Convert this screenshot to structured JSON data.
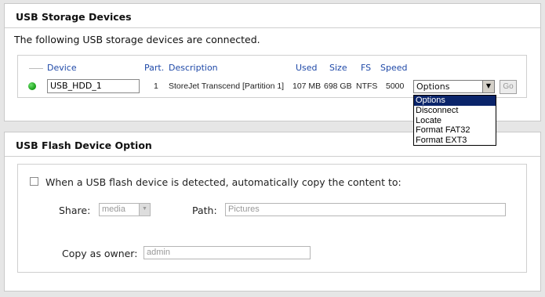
{
  "storage": {
    "title": "USB Storage Devices",
    "subtitle": "The following USB storage devices are connected.",
    "headers": {
      "device": "Device",
      "part": "Part.",
      "description": "Description",
      "used": "Used",
      "size": "Size",
      "fs": "FS",
      "speed": "Speed"
    },
    "row": {
      "status_color": "#1fa81f",
      "device_name": "USB_HDD_1",
      "part": "1",
      "description": "StoreJet Transcend [Partition 1]",
      "used": "107 MB",
      "size": "698 GB",
      "fs": "NTFS",
      "speed": "5000",
      "options_value": "Options",
      "go_label": "Go"
    },
    "dropdown_options": [
      "Options",
      "Disconnect",
      "Locate",
      "Format FAT32",
      "Format EXT3"
    ]
  },
  "flash": {
    "title": "USB Flash Device Option",
    "checkbox_label": "When a USB flash device is detected, automatically copy the content to:",
    "share_label": "Share:",
    "share_value": "media",
    "path_label": "Path:",
    "path_value": "Pictures",
    "owner_label": "Copy as owner:",
    "owner_value": "admin"
  },
  "colors": {
    "header_blue": "#1f49a8",
    "selection": "#0a246a"
  }
}
